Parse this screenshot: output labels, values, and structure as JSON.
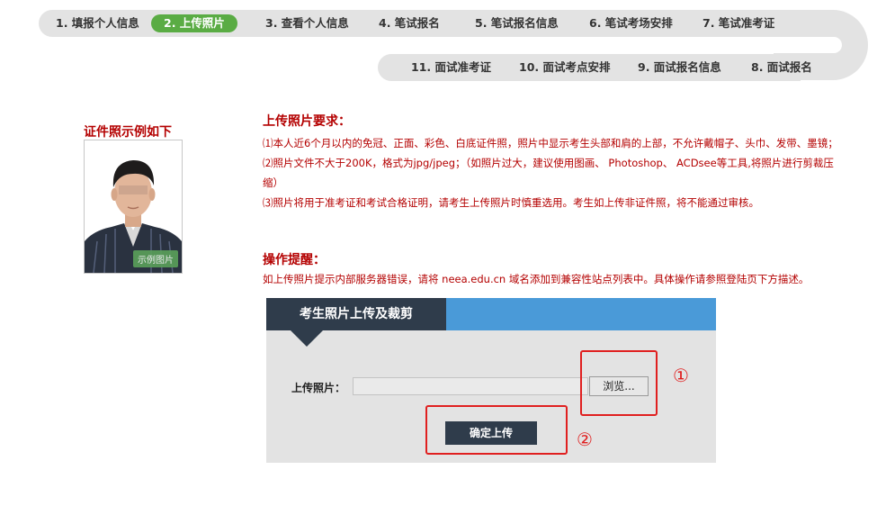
{
  "steps_top": [
    {
      "label": "1. 填报个人信息",
      "active": false
    },
    {
      "label": "2. 上传照片",
      "active": true
    },
    {
      "label": "3. 查看个人信息",
      "active": false
    },
    {
      "label": "4. 笔试报名",
      "active": false
    },
    {
      "label": "5. 笔试报名信息",
      "active": false
    },
    {
      "label": "6. 笔试考场安排",
      "active": false
    },
    {
      "label": "7. 笔试准考证",
      "active": false
    }
  ],
  "steps_bottom": [
    {
      "label": "11. 面试准考证"
    },
    {
      "label": "10. 面试考点安排"
    },
    {
      "label": "9. 面试报名信息"
    },
    {
      "label": "8. 面试报名"
    }
  ],
  "sample": {
    "title": "证件照示例如下",
    "badge": "示例图片"
  },
  "requirements": {
    "title": "上传照片要求：",
    "items": [
      "⑴本人近6个月以内的免冠、正面、彩色、白底证件照，照片中显示考生头部和肩的上部，不允许戴帽子、头巾、发带、墨镜；",
      "⑵照片文件不大于200K，格式为jpg/jpeg；（如照片过大，建议使用图画、 Photoshop、 ACDsee等工具,将照片进行剪裁压缩）",
      "⑶照片将用于准考证和考试合格证明，请考生上传照片时慎重选用。考生如上传非证件照，将不能通过审核。"
    ]
  },
  "tips": {
    "title": "操作提醒：",
    "text": "如上传照片提示内部服务器错误，请将 neea.edu.cn 域名添加到兼容性站点列表中。具体操作请参照登陆页下方描述。"
  },
  "upload_panel": {
    "tab_title": "考生照片上传及裁剪",
    "upload_label": "上传照片：",
    "browse_button": "浏览...",
    "confirm_button": "确定上传"
  },
  "annotations": {
    "marker_1": "①",
    "marker_2": "②"
  },
  "colors": {
    "active_step": "#5aac44",
    "alert_red": "#b40000",
    "panel_dark": "#2f3c4b",
    "panel_blue": "#4a9ad8",
    "annotation_red": "#e02020"
  }
}
